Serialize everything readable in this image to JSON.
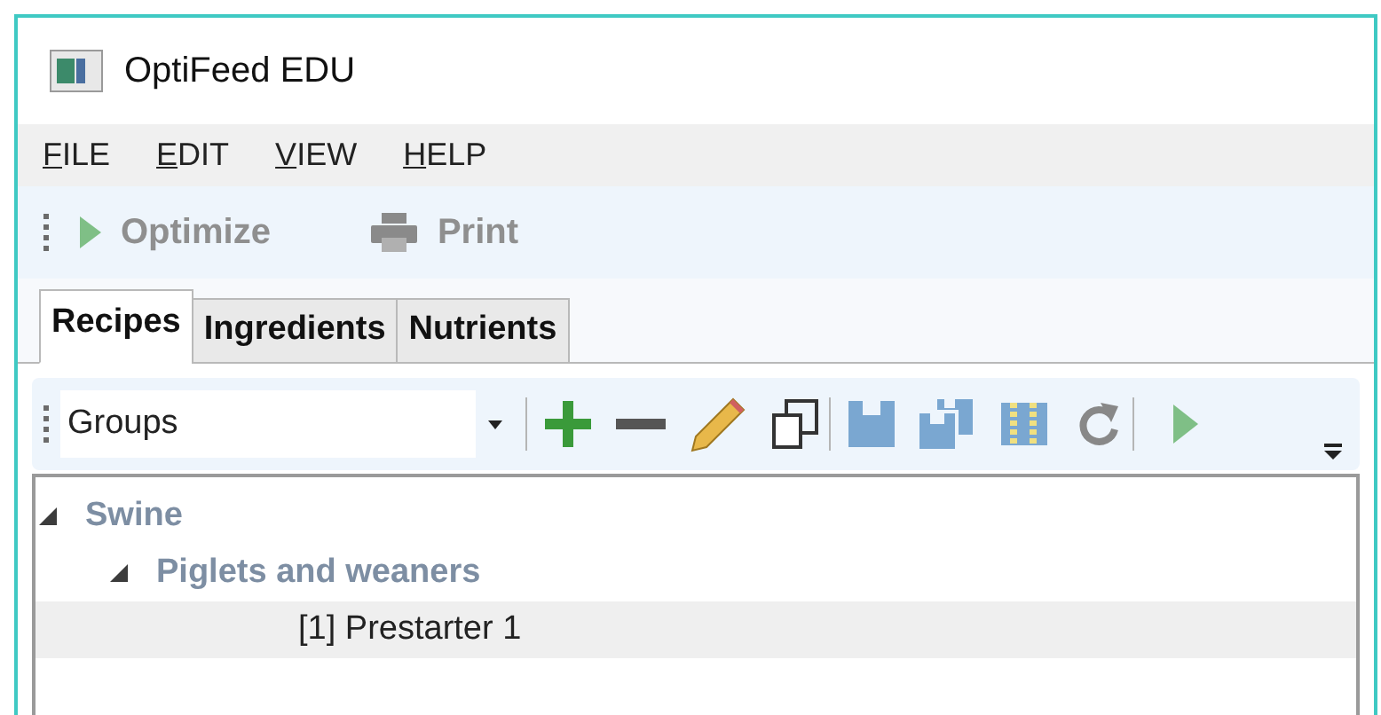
{
  "window": {
    "title": "OptiFeed EDU"
  },
  "menu": [
    "FILE",
    "EDIT",
    "VIEW",
    "HELP"
  ],
  "toolbar": [
    {
      "kind": "optimize",
      "label": "Optimize",
      "disabled": true
    },
    {
      "kind": "print",
      "label": "Print",
      "disabled": true
    }
  ],
  "tabs": [
    {
      "label": "Recipes",
      "selected": true
    },
    {
      "label": "Ingredients",
      "selected": false
    },
    {
      "label": "Nutrients",
      "selected": false
    }
  ],
  "group_select": {
    "value": "Groups"
  },
  "tree": [
    {
      "label": "Swine",
      "expanded": true,
      "selected": false,
      "children": [
        {
          "label": "Piglets and weaners",
          "expanded": true,
          "selected": false,
          "children": [
            {
              "label": "[1] Prestarter 1",
              "selected": true
            }
          ]
        }
      ]
    }
  ]
}
